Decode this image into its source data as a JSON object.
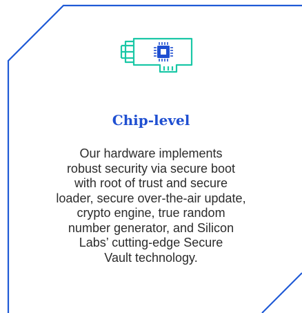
{
  "card": {
    "title": "Chip-level",
    "icon": "chip-board-icon",
    "accent_color": "#1f4fd1",
    "icon_color": "#19c7a6",
    "body_lines": [
      "Our hardware implements",
      "robust security via secure boot",
      "with root of trust and secure",
      "loader, secure over-the-air update,",
      "crypto engine, true random",
      "number generator, and Silicon",
      "Labs’ cutting-edge Secure",
      "Vault technology."
    ]
  }
}
